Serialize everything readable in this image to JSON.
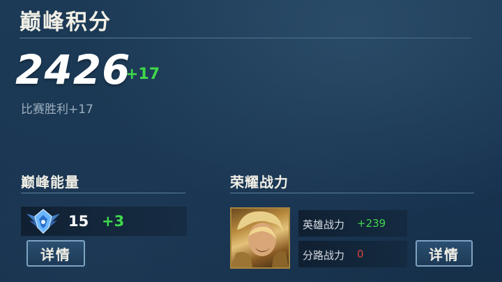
{
  "header": {
    "title": "巅峰积分"
  },
  "score": {
    "value": "2426",
    "delta": "+17",
    "detail": "比赛胜利+17"
  },
  "energy": {
    "title": "巅峰能量",
    "icon": "rank-emblem-icon",
    "value": "15",
    "delta": "+3",
    "details_label": "详情"
  },
  "power": {
    "title": "荣耀战力",
    "avatar": "hero-portrait",
    "hero_power_label": "英雄战力",
    "hero_power_delta": "+239",
    "lane_power_label": "分路战力",
    "lane_power_delta": "0",
    "details_label": "详情"
  },
  "colors": {
    "positive": "#3fd84c",
    "negative": "#d9463a",
    "accent": "#7fa3c2"
  }
}
